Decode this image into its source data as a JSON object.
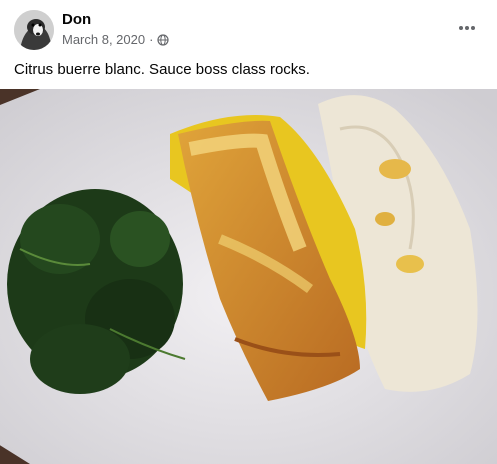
{
  "post": {
    "author": "Don",
    "date": "March 8, 2020",
    "separator": "·",
    "privacy_icon": "globe-icon",
    "more_icon": "more-horizontal-icon",
    "caption": "Citrus buerre blanc. Sauce boss class rocks."
  },
  "photo": {
    "subject": "salmon with citrus beurre blanc, spinach and rice",
    "colors": {
      "plate": "#e9e7ea",
      "table": "#4a3328",
      "salmon": "#d8922e",
      "sauce": "#e8c620",
      "spinach": "#1d3a18",
      "rice": "#ede6d6"
    }
  }
}
